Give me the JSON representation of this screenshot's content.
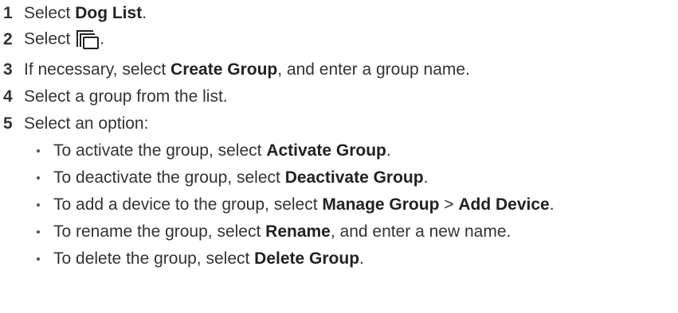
{
  "steps": [
    {
      "number": "1",
      "before": "Select ",
      "bold": "Dog List",
      "after": "."
    },
    {
      "number": "2",
      "before": "Select ",
      "icon": "stacked-windows-icon",
      "after": "."
    },
    {
      "number": "3",
      "before": "If necessary, select ",
      "bold": "Create Group",
      "after": ", and enter a group name."
    },
    {
      "number": "4",
      "text": "Select a group from the list."
    },
    {
      "number": "5",
      "text": "Select an option:"
    }
  ],
  "options": [
    {
      "before": "To activate the group, select ",
      "bold": "Activate Group",
      "after": "."
    },
    {
      "before": "To deactivate the group, select ",
      "bold": "Deactivate Group",
      "after": "."
    },
    {
      "before": "To add a device to the group, select ",
      "bold": "Manage Group",
      "middle": " > ",
      "bold2": "Add Device",
      "after": "."
    },
    {
      "before": "To rename the group, select ",
      "bold": "Rename",
      "after": ", and enter a new name."
    },
    {
      "before": "To delete the group, select ",
      "bold": "Delete Group",
      "after": "."
    }
  ]
}
